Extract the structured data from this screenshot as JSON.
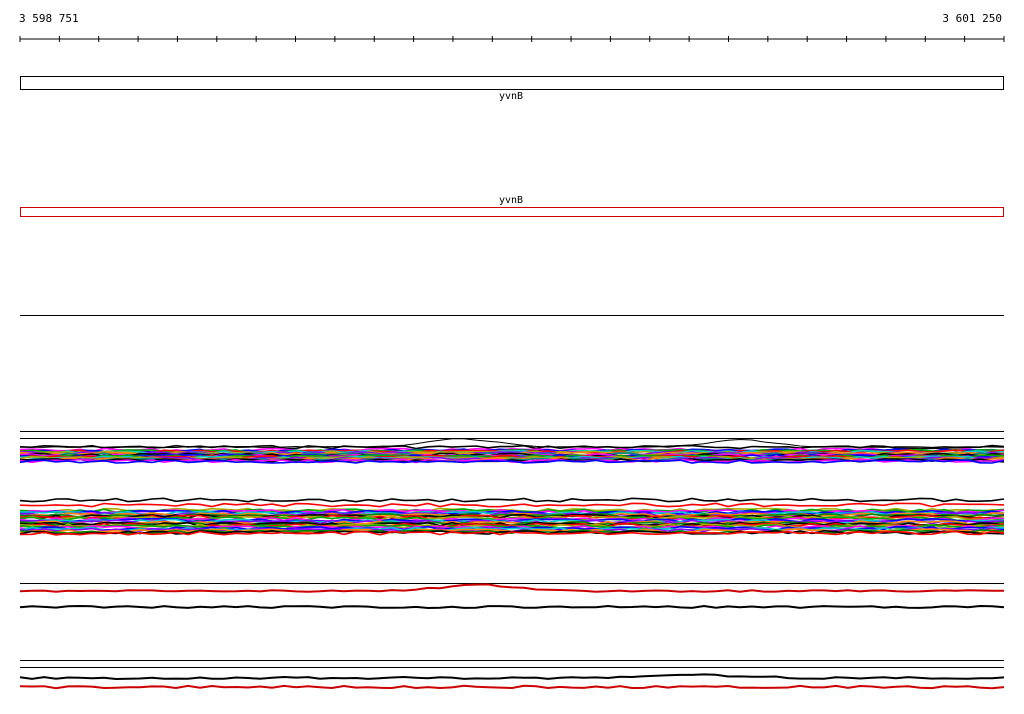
{
  "ruler": {
    "start_label": "3 598 751",
    "end_label": "3 601 250",
    "tick_count": 26
  },
  "tracks": {
    "annotation": {
      "gene_top": {
        "name": "yvnB",
        "outline_color": "#000000"
      },
      "gene_bottom": {
        "name": "yvnB",
        "outline_color": "#cc0000"
      }
    },
    "profile_groups": [
      {
        "id": "group-1",
        "line_colors": [
          "#000000",
          "#ff00ff",
          "#0000ff",
          "#00aa00",
          "#ff0000",
          "#00cccc",
          "#aaaa00",
          "#8800ff",
          "#ff8800",
          "#008888"
        ]
      },
      {
        "id": "group-2",
        "line_colors": [
          "#000000",
          "#ff0000",
          "#aaaa00",
          "#00aa00",
          "#ff00ff",
          "#0000ff",
          "#00cccc",
          "#8800ff",
          "#ff8800",
          "#008800"
        ]
      },
      {
        "id": "group-3",
        "line_colors": [
          "#cc0000",
          "#000000"
        ]
      },
      {
        "id": "group-4",
        "line_colors": [
          "#000000",
          "#cc0000"
        ]
      }
    ]
  }
}
